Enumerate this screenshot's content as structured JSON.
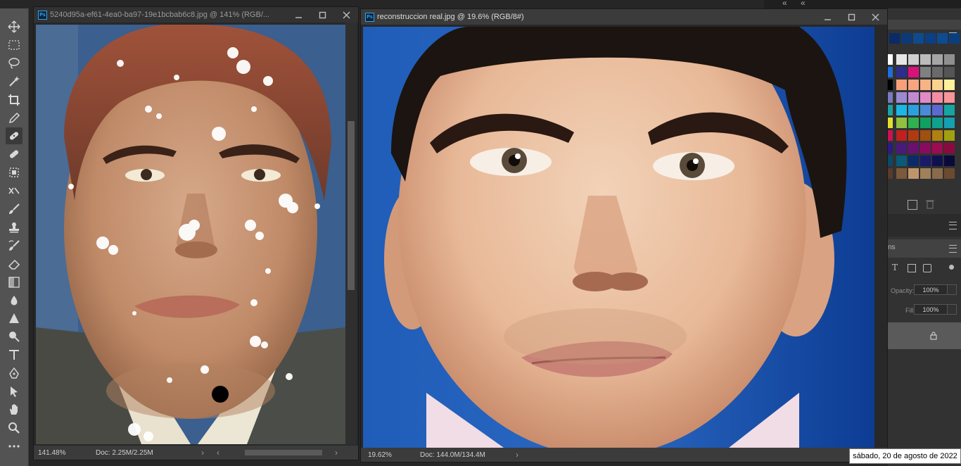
{
  "toolbar": {
    "tools": [
      {
        "name": "move-tool",
        "icon": "move-icon"
      },
      {
        "name": "marquee-tool",
        "icon": "rectangle-marquee-icon"
      },
      {
        "name": "lasso-tool",
        "icon": "lasso-icon"
      },
      {
        "name": "magic-wand-tool",
        "icon": "magic-wand-icon"
      },
      {
        "name": "crop-tool",
        "icon": "crop-icon"
      },
      {
        "name": "eyedropper-tool",
        "icon": "eyedropper-icon"
      },
      {
        "name": "healing-brush-tool",
        "icon": "healing-brush-icon",
        "active": true
      },
      {
        "name": "patch-tool",
        "icon": "bandage-icon"
      },
      {
        "name": "content-aware-tool",
        "icon": "content-aware-icon"
      },
      {
        "name": "red-eye-tool",
        "icon": "red-eye-icon"
      },
      {
        "name": "brush-tool",
        "icon": "brush-icon"
      },
      {
        "name": "clone-stamp-tool",
        "icon": "stamp-icon"
      },
      {
        "name": "history-brush-tool",
        "icon": "history-brush-icon"
      },
      {
        "name": "eraser-tool",
        "icon": "eraser-icon"
      },
      {
        "name": "gradient-tool",
        "icon": "gradient-icon"
      },
      {
        "name": "blur-tool",
        "icon": "drop-icon"
      },
      {
        "name": "sharpen-tool",
        "icon": "triangle-icon"
      },
      {
        "name": "dodge-tool",
        "icon": "dodge-icon"
      },
      {
        "name": "type-tool",
        "icon": "type-icon"
      },
      {
        "name": "pen-tool",
        "icon": "pen-icon"
      },
      {
        "name": "path-selection-tool",
        "icon": "arrow-icon"
      },
      {
        "name": "hand-tool",
        "icon": "hand-icon"
      },
      {
        "name": "zoom-tool",
        "icon": "zoom-icon"
      },
      {
        "name": "more-tools",
        "icon": "more-icon"
      }
    ]
  },
  "doc1": {
    "title": "5240d95a-ef61-4ea0-ba97-19e1bcbab6c8.jpg @ 141% (RGB/...",
    "zoom": "141.48%",
    "doc_info": "Doc: 2.25M/2.25M",
    "arrow": "›",
    "scroll_left": "‹",
    "scroll_right": "›"
  },
  "doc2": {
    "title": "reconstruccion real.jpg @ 19.6% (RGB/8#)",
    "zoom": "19.62%",
    "doc_info": "Doc: 144.0M/134.4M",
    "arrow": "›"
  },
  "ps_badge": "Ps",
  "layers_panel": {
    "tab_fragment": "ns",
    "opacity_label": "Opacity:",
    "opacity_value": "100%",
    "fill_label": "Fill:",
    "fill_value": "100%"
  },
  "collapse_glyph": "«",
  "swatches": {
    "top_row": [
      "#0a2b66",
      "#0c3a78",
      "#0e4a8e",
      "#0b3f86",
      "#0d4b93",
      "#0a3f7f"
    ],
    "rows": [
      [
        "#ffffff",
        "#e6e6e6",
        "#d0d0d0",
        "#bbbbbb",
        "#a5a5a5",
        "#8f8f8f"
      ],
      [
        "#1e6fd9",
        "#2d2d8f",
        "#d9127a",
        "#808080",
        "#6a6a6a",
        "#555555"
      ],
      [
        "#000000",
        "#f7a07a",
        "#f6a580",
        "#f8b384",
        "#fbd28c",
        "#fff199"
      ],
      [
        "#7a7abf",
        "#9b8ad1",
        "#c08ad3",
        "#e08ac8",
        "#f58ca6",
        "#f6969a"
      ],
      [
        "#1aa3a3",
        "#1ab6e6",
        "#2aa0e0",
        "#4a8ad8",
        "#5a6ad0",
        "#16a6a0"
      ],
      [
        "#e0e030",
        "#90c040",
        "#30b050",
        "#10a060",
        "#10a090",
        "#14a0b0"
      ],
      [
        "#d01050",
        "#c0201e",
        "#b03a12",
        "#a05010",
        "#b08010",
        "#a0a010"
      ],
      [
        "#2a1a8a",
        "#4a1a7a",
        "#6a1070",
        "#8a0a60",
        "#a00a50",
        "#8a0a40"
      ],
      [
        "#0a4a6a",
        "#0a5a7a",
        "#0a2a6a",
        "#1a1a6a",
        "#101050",
        "#0a0a3a"
      ],
      [
        "#5a3a2a",
        "#7a5a3a",
        "#c0946a",
        "#a0805a",
        "#8a6a4a",
        "#6a4a30"
      ]
    ]
  }
}
